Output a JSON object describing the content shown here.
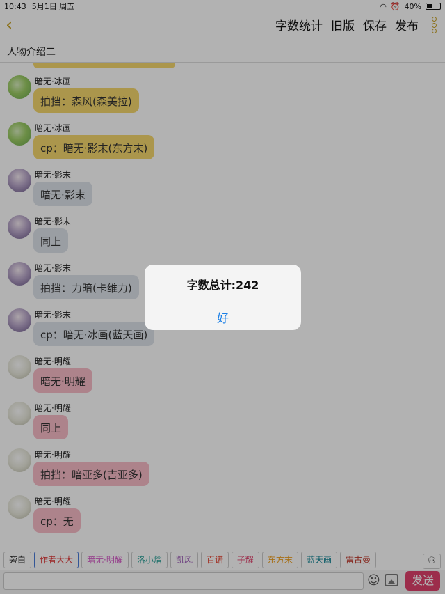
{
  "status": {
    "time": "10:43",
    "date": "5月1日 周五",
    "battery": "40%"
  },
  "nav": {
    "back_icon": "‹",
    "actions": [
      "字数统计",
      "旧版",
      "保存",
      "发布"
    ]
  },
  "title": "人物介绍二",
  "messages": [
    {
      "name": "暗无·冰画",
      "text": "拍挡：森风(森美拉)",
      "color": "yellow"
    },
    {
      "name": "暗无·冰画",
      "text": "cp：暗无·影末(东方末)",
      "color": "yellow"
    },
    {
      "name": "暗无·影末",
      "text": "暗无·影末",
      "color": "gray"
    },
    {
      "name": "暗无·影末",
      "text": "同上",
      "color": "gray"
    },
    {
      "name": "暗无·影末",
      "text": "拍挡：力暗(卡维力)",
      "color": "gray"
    },
    {
      "name": "暗无·影末",
      "text": "cp：暗无·冰画(蓝天画)",
      "color": "gray"
    },
    {
      "name": "暗无·明耀",
      "text": "暗无·明耀",
      "color": "pink"
    },
    {
      "name": "暗无·明耀",
      "text": "同上",
      "color": "pink"
    },
    {
      "name": "暗无·明耀",
      "text": "拍挡：暗亚多(吉亚多)",
      "color": "pink"
    },
    {
      "name": "暗无·明耀",
      "text": "cp：无",
      "color": "pink"
    }
  ],
  "dialog": {
    "message": "字数总计:242",
    "ok": "好"
  },
  "roles": [
    {
      "label": "旁白",
      "color": "#222222"
    },
    {
      "label": "作者大大",
      "color": "#e03c3c"
    },
    {
      "label": "暗无·明耀",
      "color": "#d65ac8"
    },
    {
      "label": "洛小熠",
      "color": "#2aa198"
    },
    {
      "label": "凯风",
      "color": "#9b59b6"
    },
    {
      "label": "百诺",
      "color": "#e74c3c"
    },
    {
      "label": "子耀",
      "color": "#e0416c"
    },
    {
      "label": "东方末",
      "color": "#f0a020"
    },
    {
      "label": "蓝天画",
      "color": "#1b8a9a"
    },
    {
      "label": "雷古曼",
      "color": "#c0392b"
    }
  ],
  "input": {
    "send": "发送"
  },
  "colors": {
    "accent": "#c9a227",
    "send": "#e0416c",
    "dialog_button": "#1a7fe6"
  }
}
